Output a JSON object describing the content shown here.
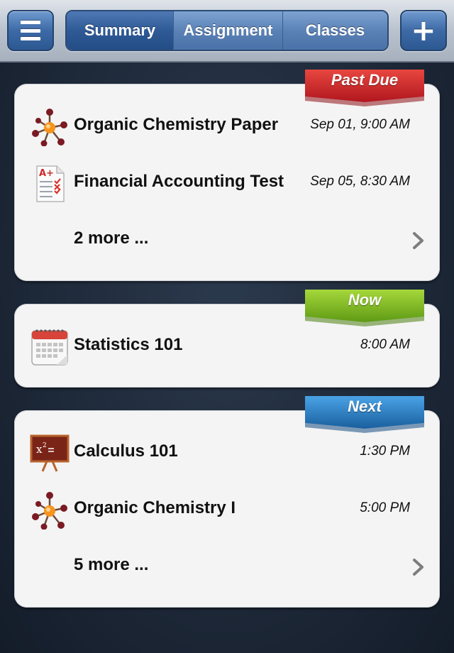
{
  "topbar": {
    "menu_icon": "hamburger-menu-icon",
    "tabs": [
      {
        "label": "Summary",
        "selected": true
      },
      {
        "label": "Assignment",
        "selected": false
      },
      {
        "label": "Classes",
        "selected": false
      }
    ],
    "add_icon": "plus-icon"
  },
  "sections": {
    "past_due": {
      "ribbon_label": "Past Due",
      "ribbon_color": "#c8242b",
      "items": [
        {
          "title": "Organic Chemistry Paper",
          "time": "Sep 01, 9:00 AM",
          "icon": "molecule-icon"
        },
        {
          "title": "Financial Accounting Test",
          "time": "Sep 05, 8:30 AM",
          "icon": "graded-test-icon"
        }
      ],
      "more_label": "2 more ..."
    },
    "now": {
      "ribbon_label": "Now",
      "ribbon_color": "#7fb823",
      "items": [
        {
          "title": "Statistics 101",
          "time": "8:00 AM",
          "icon": "calendar-icon"
        }
      ]
    },
    "next": {
      "ribbon_label": "Next",
      "ribbon_color": "#2c82c9",
      "items": [
        {
          "title": "Calculus 101",
          "time": "1:30 PM",
          "icon": "chalkboard-icon"
        },
        {
          "title": "Organic Chemistry I",
          "time": "5:00 PM",
          "icon": "molecule-icon"
        }
      ],
      "more_label": "5 more ..."
    }
  }
}
